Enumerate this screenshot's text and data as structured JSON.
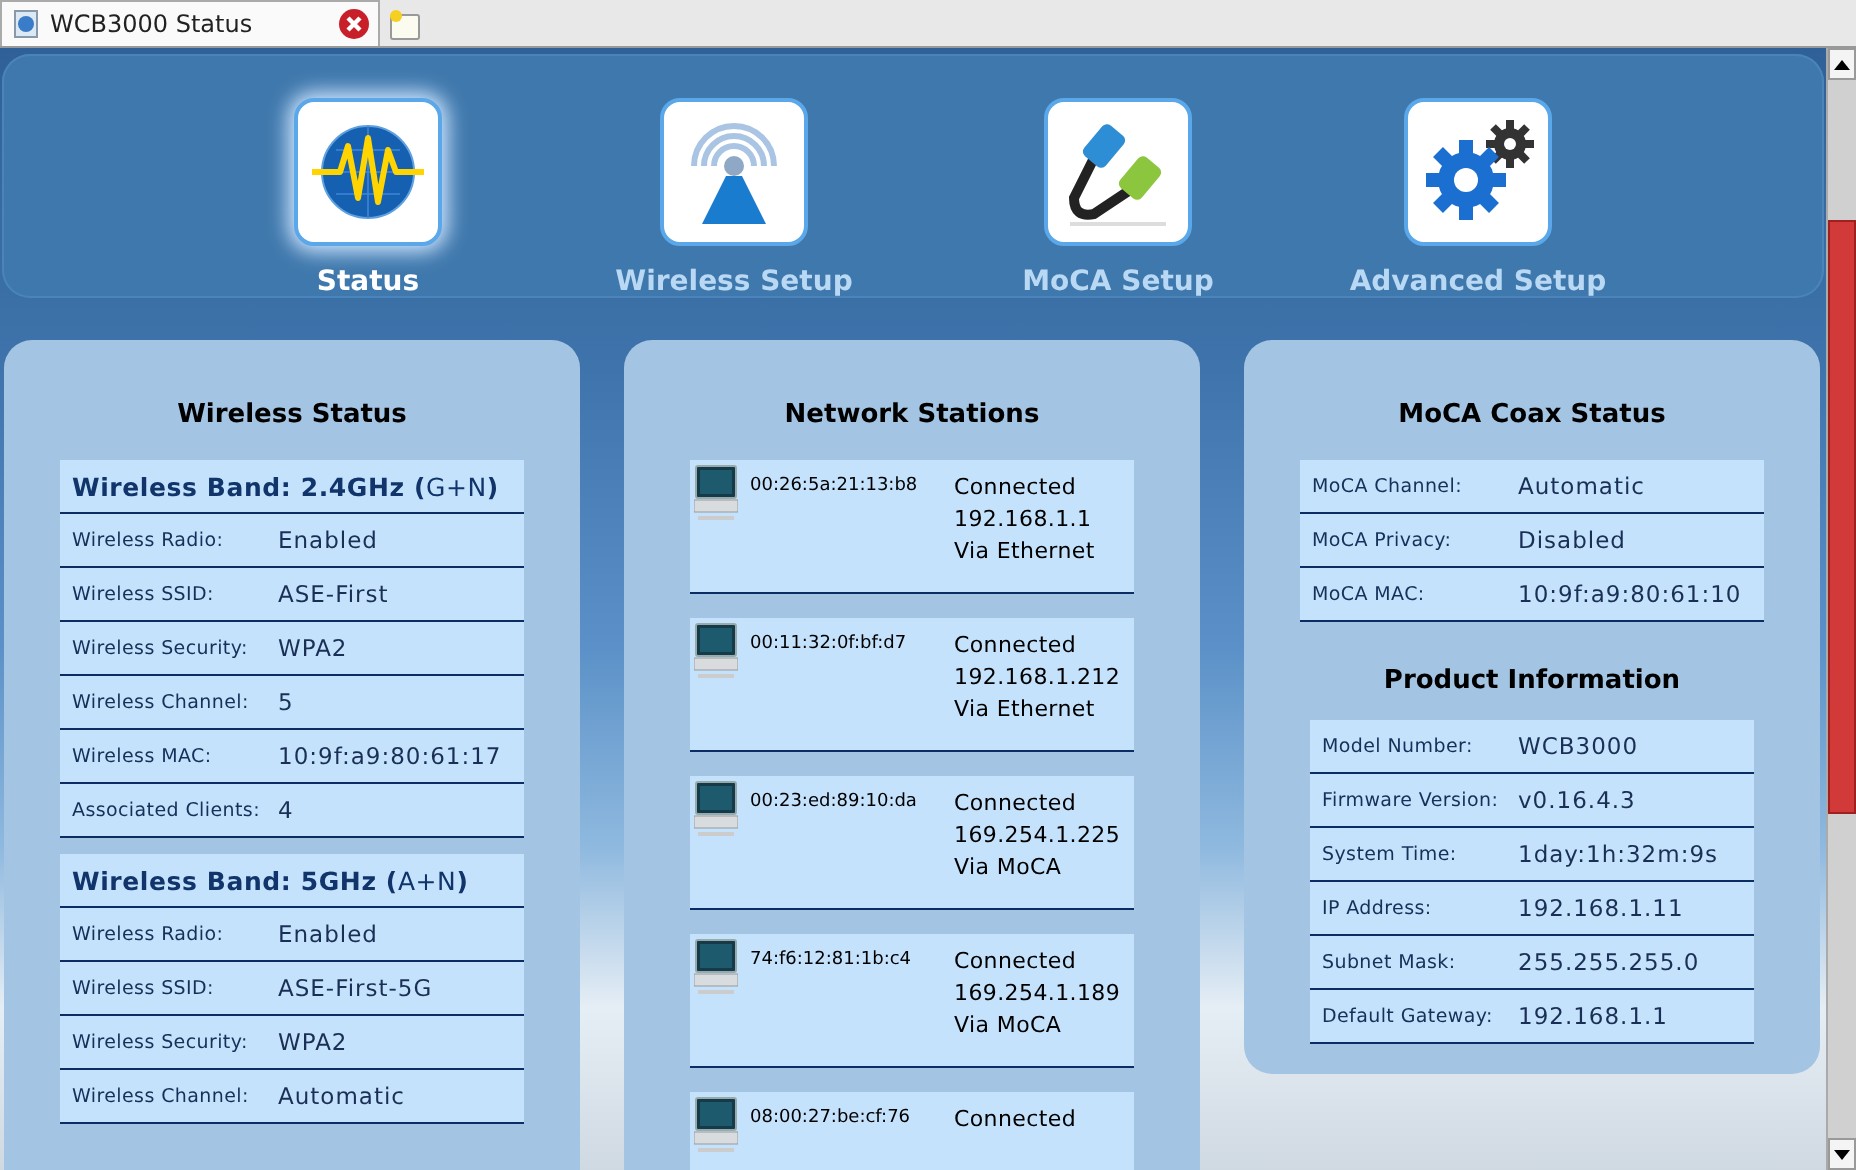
{
  "browser_tab": {
    "title": "WCB3000 Status"
  },
  "nav": {
    "items": [
      {
        "label": "Status",
        "kind": "status",
        "selected": true
      },
      {
        "label": "Wireless Setup",
        "kind": "wireless",
        "selected": false
      },
      {
        "label": "MoCA Setup",
        "kind": "moca",
        "selected": false
      },
      {
        "label": "Advanced Setup",
        "kind": "advanced",
        "selected": false
      }
    ]
  },
  "wireless_status": {
    "title": "Wireless Status",
    "bands": [
      {
        "header": "**Wireless Band: 2.4GHz (**G+N**)**",
        "rows": [
          {
            "label": "Wireless Radio:",
            "value": "Enabled"
          },
          {
            "label": "Wireless SSID:",
            "value": "ASE-First"
          },
          {
            "label": "Wireless Security:",
            "value": "WPA2"
          },
          {
            "label": "Wireless Channel:",
            "value": "5"
          },
          {
            "label": "Wireless MAC:",
            "value": "10:9f:a9:80:61:17"
          },
          {
            "label": "Associated Clients:",
            "value": "4"
          }
        ]
      },
      {
        "header": "**Wireless Band: 5GHz (**A+N**)**",
        "rows": [
          {
            "label": "Wireless Radio:",
            "value": "Enabled"
          },
          {
            "label": "Wireless SSID:",
            "value": "ASE-First-5G"
          },
          {
            "label": "Wireless Security:",
            "value": "WPA2"
          },
          {
            "label": "Wireless Channel:",
            "value": "Automatic"
          }
        ]
      }
    ]
  },
  "network_stations": {
    "title": "Network Stations",
    "stations": [
      {
        "mac": "00:26:5a:21:13:b8",
        "lines": [
          "Connected",
          "192.168.1.1",
          "Via Ethernet"
        ]
      },
      {
        "mac": "00:11:32:0f:bf:d7",
        "lines": [
          "Connected",
          "192.168.1.212",
          "Via Ethernet"
        ]
      },
      {
        "mac": "00:23:ed:89:10:da",
        "lines": [
          "Connected",
          "169.254.1.225",
          "Via MoCA"
        ]
      },
      {
        "mac": "74:f6:12:81:1b:c4",
        "lines": [
          "Connected",
          "169.254.1.189",
          "Via MoCA"
        ]
      },
      {
        "mac": "08:00:27:be:cf:76",
        "lines": [
          "Connected"
        ]
      }
    ]
  },
  "moca_coax_status": {
    "title": "MoCA Coax Status",
    "rows": [
      {
        "label": "MoCA Channel:",
        "value": "Automatic"
      },
      {
        "label": "MoCA Privacy:",
        "value": "Disabled"
      },
      {
        "label": "MoCA MAC:",
        "value": "10:9f:a9:80:61:10"
      }
    ]
  },
  "product_information": {
    "title": "Product Information",
    "rows": [
      {
        "label": "Model Number:",
        "value": "WCB3000"
      },
      {
        "label": "Firmware Version:",
        "value": "v0.16.4.3"
      },
      {
        "label": "System Time:",
        "value": "1day:1h:32m:9s"
      },
      {
        "label": "IP Address:",
        "value": "192.168.1.11"
      },
      {
        "label": "Subnet Mask:",
        "value": "255.255.255.0"
      },
      {
        "label": "Default Gateway:",
        "value": "192.168.1.1"
      }
    ]
  }
}
